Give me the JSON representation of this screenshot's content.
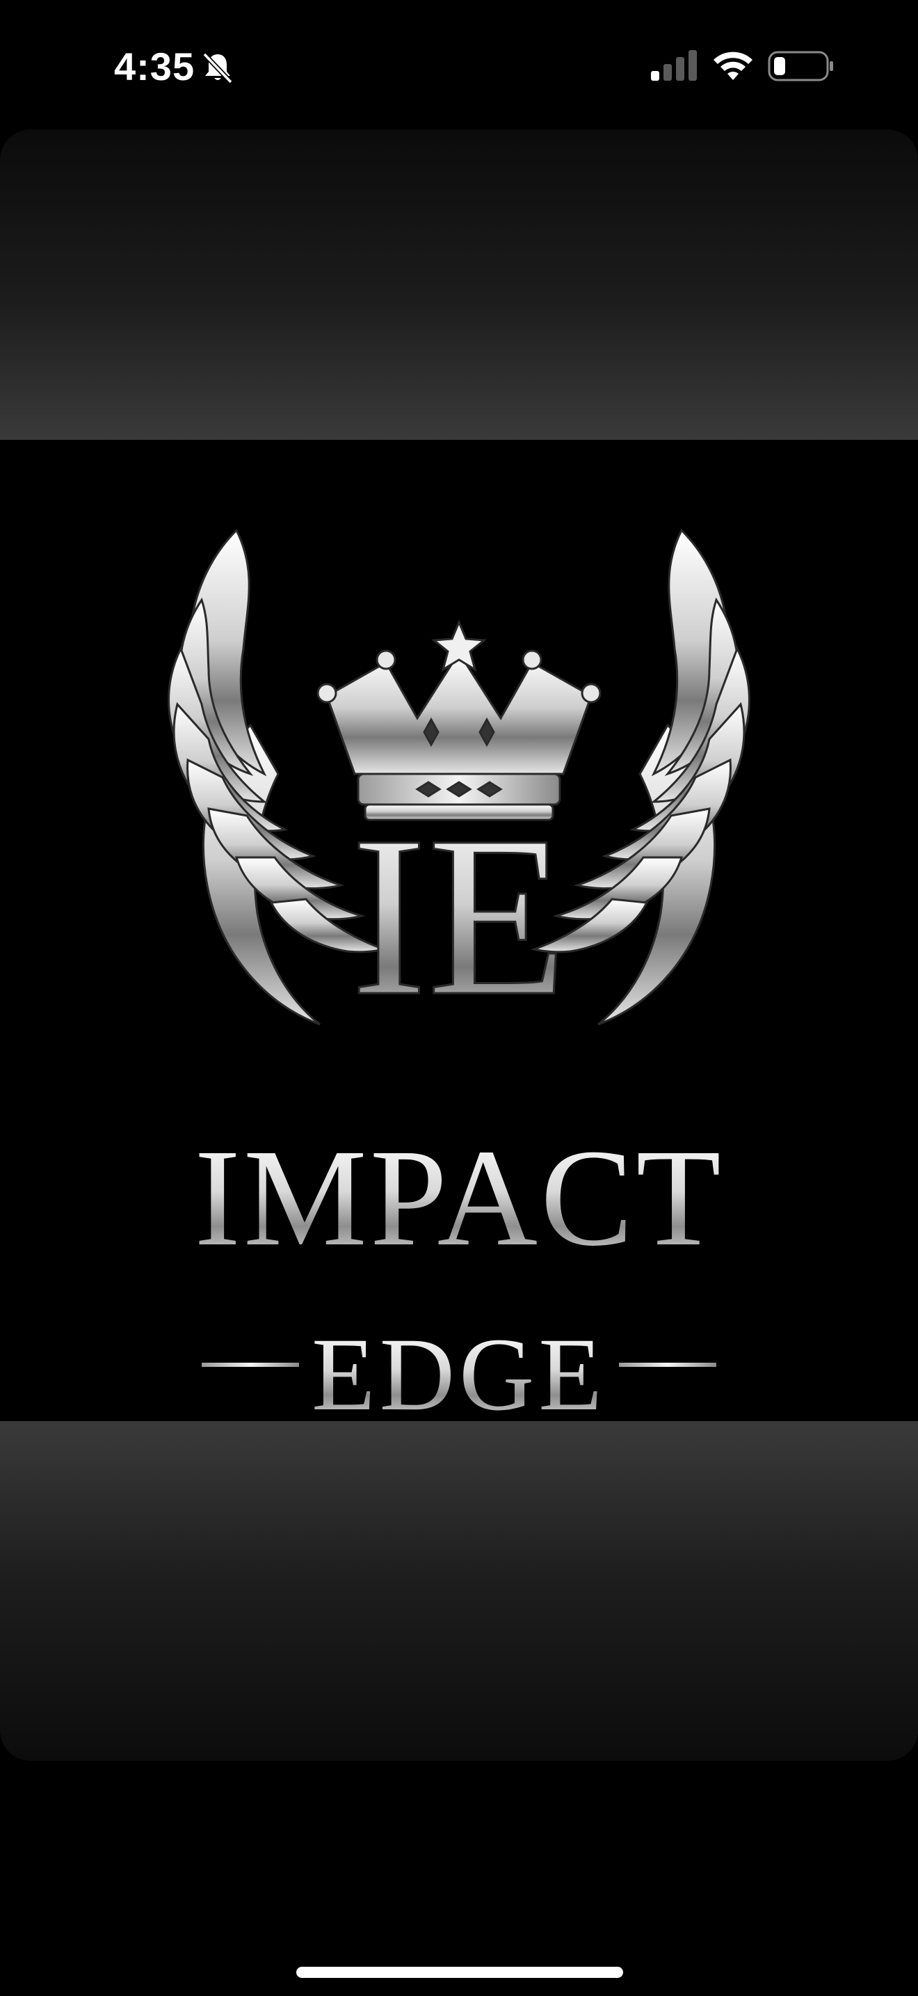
{
  "status_bar": {
    "time": "4:35",
    "icons": {
      "silent": "bell-slash-icon",
      "signal": "cellular-signal-icon",
      "wifi": "wifi-icon",
      "battery": "battery-low-icon"
    }
  },
  "image": {
    "monogram": "IE",
    "brand_line_1": "IMPACT",
    "brand_line_2": "EDGE",
    "emblem_icons": [
      "crown-icon",
      "left-wing-icon",
      "right-wing-icon"
    ],
    "colors": {
      "background": "#000000",
      "metal_light": "#f2f2f2",
      "metal_dark": "#7a7a7a"
    }
  }
}
